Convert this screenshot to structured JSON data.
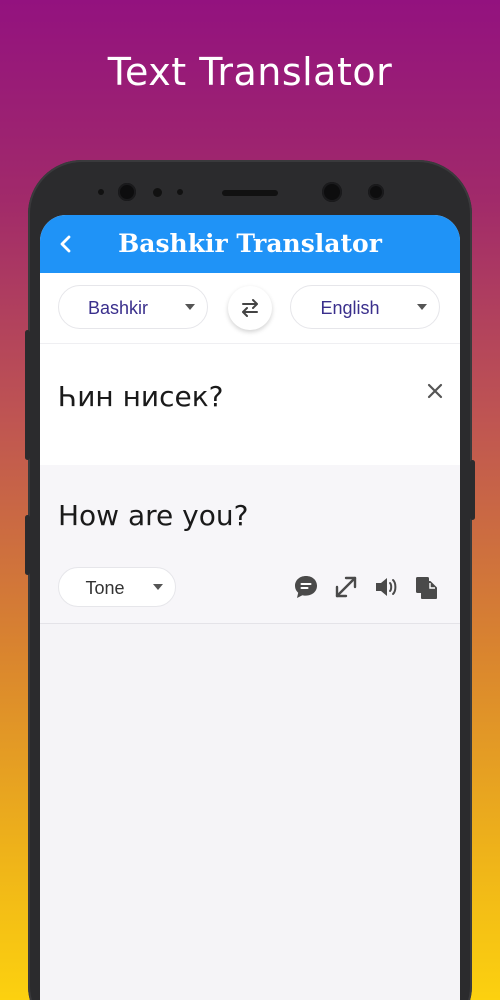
{
  "promo": {
    "title": "Text Translator"
  },
  "appbar": {
    "title": "Bashkir Translator"
  },
  "languages": {
    "source": "Bashkir",
    "target": "English"
  },
  "input": {
    "text": "Һин нисек?"
  },
  "output": {
    "text": "How are you?",
    "tone_label": "Tone"
  },
  "colors": {
    "appbar": "#1f93f7",
    "language_text": "#3a2f8c",
    "icon": "#4a4a4a"
  },
  "icons": {
    "back": "chevron-left-icon",
    "swap": "swap-arrows-icon",
    "clear": "close-icon",
    "chat": "chat-bubble-icon",
    "expand": "expand-diagonal-icon",
    "speaker": "speaker-volume-icon",
    "copy": "copy-documents-icon"
  }
}
